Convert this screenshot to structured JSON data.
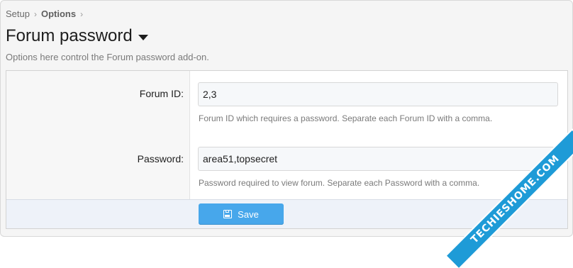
{
  "breadcrumb": {
    "items": [
      "Setup",
      "Options"
    ],
    "separator": "›"
  },
  "page": {
    "title": "Forum password",
    "description": "Options here control the Forum password add-on."
  },
  "form": {
    "forum_id": {
      "label": "Forum ID:",
      "value": "2,3",
      "hint": "Forum ID which requires a password. Separate each Forum ID with a comma."
    },
    "password": {
      "label": "Password:",
      "value": "area51,topsecret",
      "hint": "Password required to view forum. Separate each Password with a comma."
    },
    "save_label": "Save"
  },
  "watermark": {
    "text": "TECHIESHOME.COM"
  },
  "colors": {
    "accent": "#47a7eb",
    "footer_bg": "#eef2f9",
    "watermark_bg": "#1e9bd7"
  },
  "icons": {
    "caret": "caret-down-icon",
    "save": "save-icon"
  }
}
